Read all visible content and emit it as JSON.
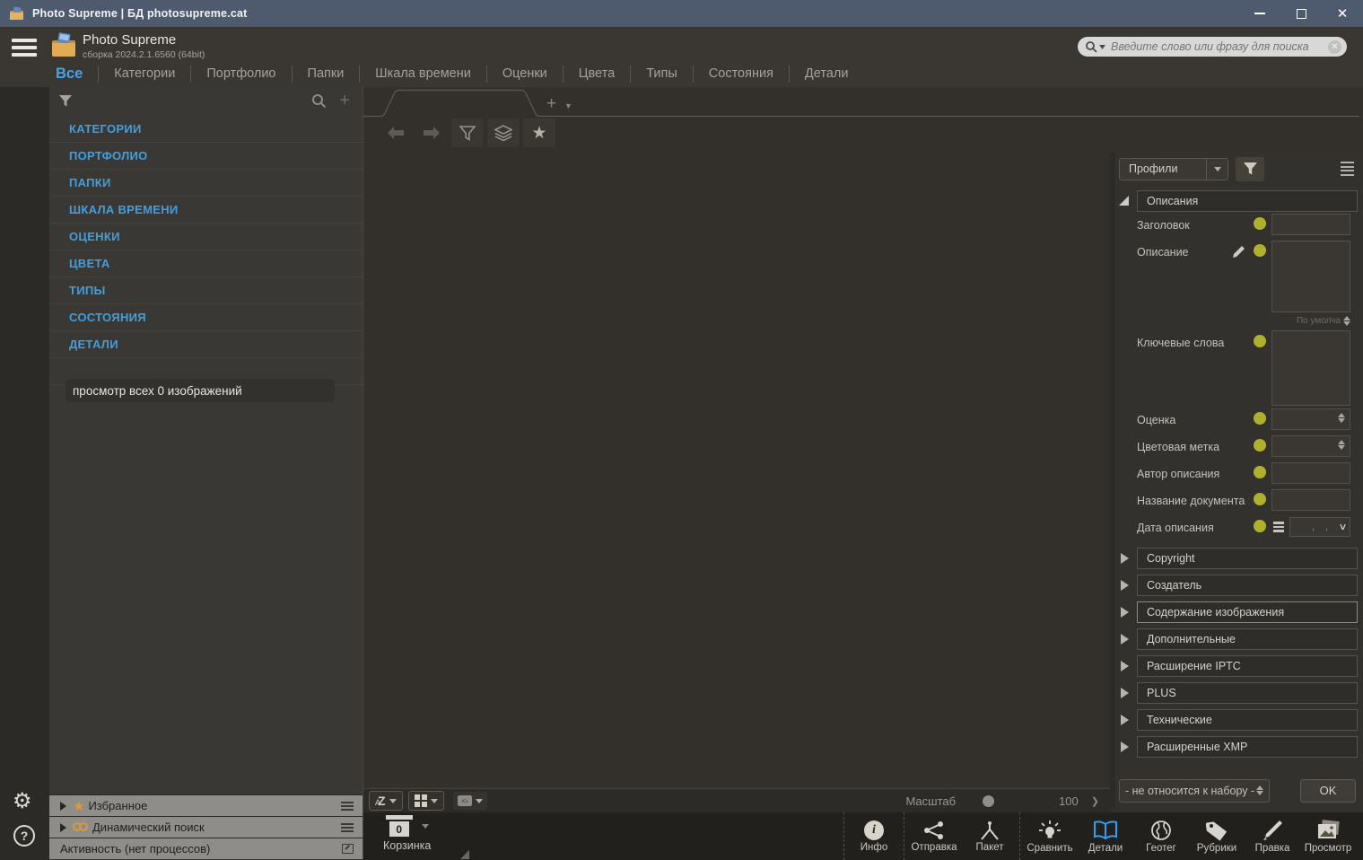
{
  "titlebar": {
    "title": "Photo Supreme | БД photosupreme.cat"
  },
  "header": {
    "app_name": "Photo Supreme",
    "build": "сборка 2024.2.1.6560 (64bit)",
    "search_placeholder": "Введите слово или фразу для поиска"
  },
  "tabs": [
    {
      "label": "Все"
    },
    {
      "label": "Категории"
    },
    {
      "label": "Портфолио"
    },
    {
      "label": "Папки"
    },
    {
      "label": "Шкала времени"
    },
    {
      "label": "Оценки"
    },
    {
      "label": "Цвета"
    },
    {
      "label": "Типы"
    },
    {
      "label": "Состояния"
    },
    {
      "label": "Детали"
    }
  ],
  "sidebar": {
    "items": [
      {
        "label": "КАТЕГОРИИ"
      },
      {
        "label": "ПОРТФОЛИО"
      },
      {
        "label": "ПАПКИ"
      },
      {
        "label": "ШКАЛА ВРЕМЕНИ"
      },
      {
        "label": "ОЦЕНКИ"
      },
      {
        "label": "ЦВЕТА"
      },
      {
        "label": "ТИПЫ"
      },
      {
        "label": "СОСТОЯНИЯ"
      },
      {
        "label": "ДЕТАЛИ"
      }
    ],
    "view_all": "просмотр всех 0 изображений"
  },
  "bottom_panels": {
    "favorites": "Избранное",
    "dynamic_search": "Динамический поиск",
    "activity": "Активность (нет процессов)"
  },
  "canvas_footer": {
    "sort_label": "AZ",
    "zoom_label": "Масштаб",
    "zoom_value": "100"
  },
  "basket": {
    "label": "Корзинка",
    "count": "0"
  },
  "dock": [
    {
      "label": "Инфо"
    },
    {
      "label": "Отправка"
    },
    {
      "label": "Пакет"
    },
    {
      "label": "Сравнить"
    },
    {
      "label": "Детали"
    },
    {
      "label": "Геотег"
    },
    {
      "label": "Рубрики"
    },
    {
      "label": "Правка"
    },
    {
      "label": "Просмотр"
    }
  ],
  "right_panel": {
    "profile_combo": "Профили",
    "descriptions": {
      "title": "Описания",
      "fields": [
        {
          "label": "Заголовок"
        },
        {
          "label": "Описание"
        },
        {
          "label": "Ключевые слова"
        },
        {
          "label": "Оценка"
        },
        {
          "label": "Цветовая метка"
        },
        {
          "label": "Автор описания"
        },
        {
          "label": "Название документа"
        },
        {
          "label": "Дата описания"
        }
      ],
      "default_lang": "По умолча"
    },
    "collapsed_sections": [
      {
        "label": "Copyright"
      },
      {
        "label": "Создатель"
      },
      {
        "label": "Содержание изображения"
      },
      {
        "label": "Дополнительные"
      },
      {
        "label": "Расширение IPTC"
      },
      {
        "label": "PLUS"
      },
      {
        "label": "Технические"
      },
      {
        "label": "Расширенные XMP"
      }
    ],
    "set_selector": "- не относится к набору -",
    "ok_label": "OK"
  },
  "colors": {
    "accent_blue": "#46a4e6",
    "keyword_yellow": "#b1b128",
    "orange": "#de9b35",
    "titlebar": "#4e5b6e"
  }
}
